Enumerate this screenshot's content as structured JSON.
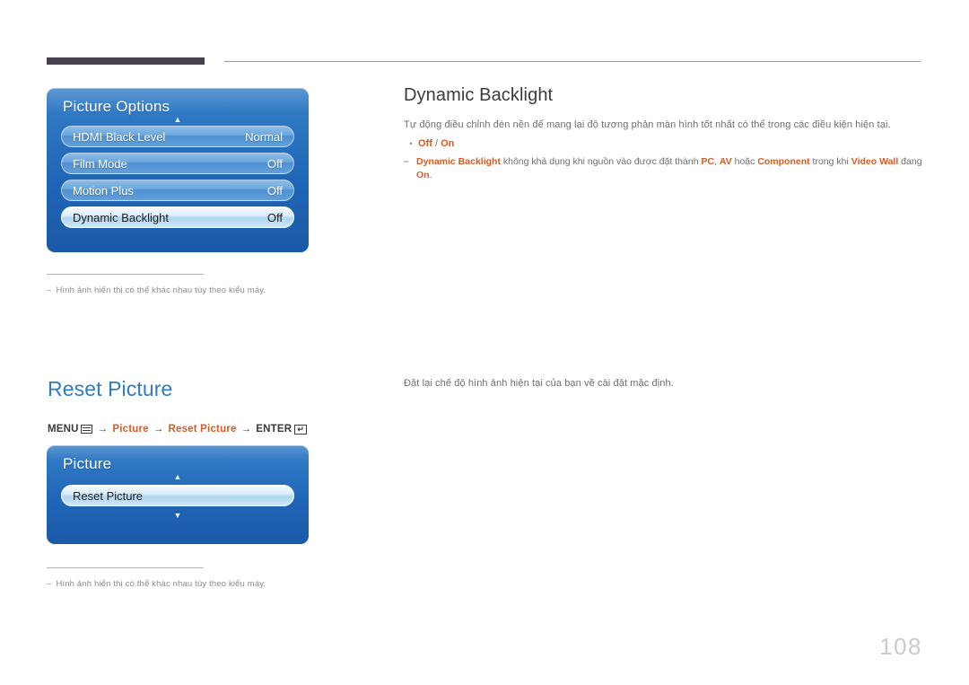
{
  "page": {
    "number": "108"
  },
  "sections": [
    {
      "id": "dynamic-backlight",
      "heading": "Dynamic Backlight",
      "description": "Tự động điều chỉnh đèn nền để mang lại độ tương phản màn hình tốt nhất có thể trong các điều kiện hiện tại.",
      "options": {
        "left": "Off",
        "separator": " / ",
        "right": "On"
      },
      "note": {
        "dash": "⎯",
        "parts": [
          {
            "text": "Dynamic Backlight",
            "highlight": true
          },
          {
            "text": " không khả dụng khi nguồn vào được đặt thành ",
            "highlight": false
          },
          {
            "text": "PC",
            "highlight": true
          },
          {
            "text": ", ",
            "highlight": false
          },
          {
            "text": "AV",
            "highlight": true
          },
          {
            "text": " hoặc ",
            "highlight": false
          },
          {
            "text": "Component",
            "highlight": true
          },
          {
            "text": " trong khi ",
            "highlight": false
          },
          {
            "text": "Video Wall",
            "highlight": true
          },
          {
            "text": " đang ",
            "highlight": false
          },
          {
            "text": "On",
            "highlight": true
          },
          {
            "text": ".",
            "highlight": false
          }
        ]
      },
      "osd": {
        "title": "Picture Options",
        "up_arrow": "▲",
        "rows": [
          {
            "label": "HDMI Black Level",
            "value": "Normal",
            "selected": false
          },
          {
            "label": "Film Mode",
            "value": "Off",
            "selected": false
          },
          {
            "label": "Motion Plus",
            "value": "Off",
            "selected": false
          },
          {
            "label": "Dynamic Backlight",
            "value": "Off",
            "selected": true
          }
        ]
      },
      "footnote": {
        "dash": "‒",
        "text": "Hình ảnh hiển thị có thể khác nhau tùy theo kiểu máy."
      }
    },
    {
      "id": "reset-picture",
      "heading": "Reset Picture",
      "description": "Đặt lại chế độ hình ảnh hiện tại của bạn về cài đặt mặc định.",
      "menu_path": {
        "menu_label": "MENU",
        "menu_icon": "menu-grid-icon",
        "arrow": "→",
        "step1": "Picture",
        "step2": "Reset Picture",
        "enter_label": "ENTER",
        "enter_icon": "enter-return-icon",
        "enter_glyph": "↵"
      },
      "osd": {
        "title": "Picture",
        "up_arrow": "▲",
        "down_arrow": "▼",
        "rows": [
          {
            "label": "Reset Picture",
            "value": "",
            "selected": true
          }
        ]
      },
      "footnote": {
        "dash": "‒",
        "text": "Hình ảnh hiển thị có thể khác nhau tùy theo kiểu máy."
      }
    }
  ]
}
